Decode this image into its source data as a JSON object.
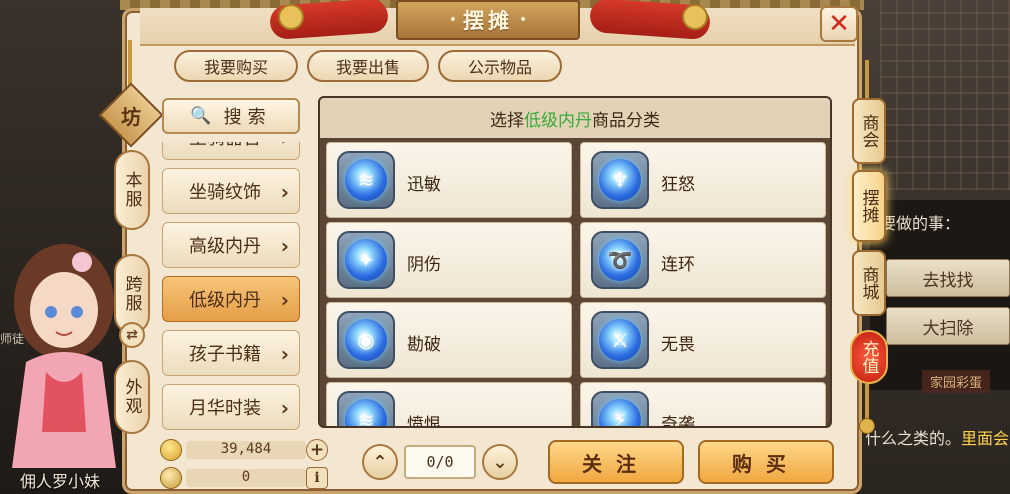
{
  "title": {
    "text": "摆摊",
    "dot_left": "•",
    "dot_right": "•"
  },
  "close_glyph": "✕",
  "top_tabs": [
    {
      "label": "我要购买"
    },
    {
      "label": "我要出售"
    },
    {
      "label": "公示物品"
    }
  ],
  "left_badge": "坊",
  "left_tabs": [
    {
      "label": "本服"
    },
    {
      "label": "跨服"
    },
    {
      "label": "外观"
    }
  ],
  "swap_glyph": "⇄",
  "search": {
    "icon": "search-icon",
    "glyph": "🔍",
    "label": "搜索"
  },
  "categories": [
    {
      "label": "坐骑器官",
      "partial": true
    },
    {
      "label": "坐骑纹饰"
    },
    {
      "label": "高级内丹"
    },
    {
      "label": "低级内丹",
      "selected": true
    },
    {
      "label": "孩子书籍"
    },
    {
      "label": "月华时装"
    }
  ],
  "arrow_glyph": "›",
  "grid": {
    "header_prefix": "选择",
    "header_highlight": "低级内丹",
    "header_suffix": "商品分类",
    "items": [
      {
        "name": "迅敏",
        "mark": "≋"
      },
      {
        "name": "狂怒",
        "mark": "♆"
      },
      {
        "name": "阴伤",
        "mark": "✦"
      },
      {
        "name": "连环",
        "mark": "➰"
      },
      {
        "name": "勘破",
        "mark": "◉"
      },
      {
        "name": "无畏",
        "mark": "⚔"
      },
      {
        "name": "愤恨",
        "mark": "≋"
      },
      {
        "name": "奇袭",
        "mark": "⚡"
      }
    ]
  },
  "currency": [
    {
      "icon": "gold-coin-icon",
      "value": "39,484",
      "action_glyph": "+"
    },
    {
      "icon": "silver-coin-icon",
      "value": "0",
      "action_glyph": "i"
    }
  ],
  "pager": {
    "up": "⌃",
    "down": "⌄",
    "value": "0/0"
  },
  "actions": {
    "follow": "关注",
    "buy": "购买"
  },
  "right_tabs": [
    {
      "label": "商会"
    },
    {
      "label": "摆摊",
      "active": true
    },
    {
      "label": "商城"
    },
    {
      "label": "充值"
    }
  ],
  "background": {
    "task_title": "要做的事：",
    "task_btn_1": "去找找",
    "task_btn_2": "大扫除",
    "family_label": "家园彩蛋",
    "chat_prefix": "什么之类的。",
    "chat_highlight": "里面会",
    "side_chat": "师徒",
    "servant_name": "佣人罗小妹"
  },
  "colors": {
    "accent_green": "#3aaa3a",
    "selected_orange": "#e59e47",
    "close_red": "#d32a1e",
    "gold_text": "#ffd34a"
  }
}
